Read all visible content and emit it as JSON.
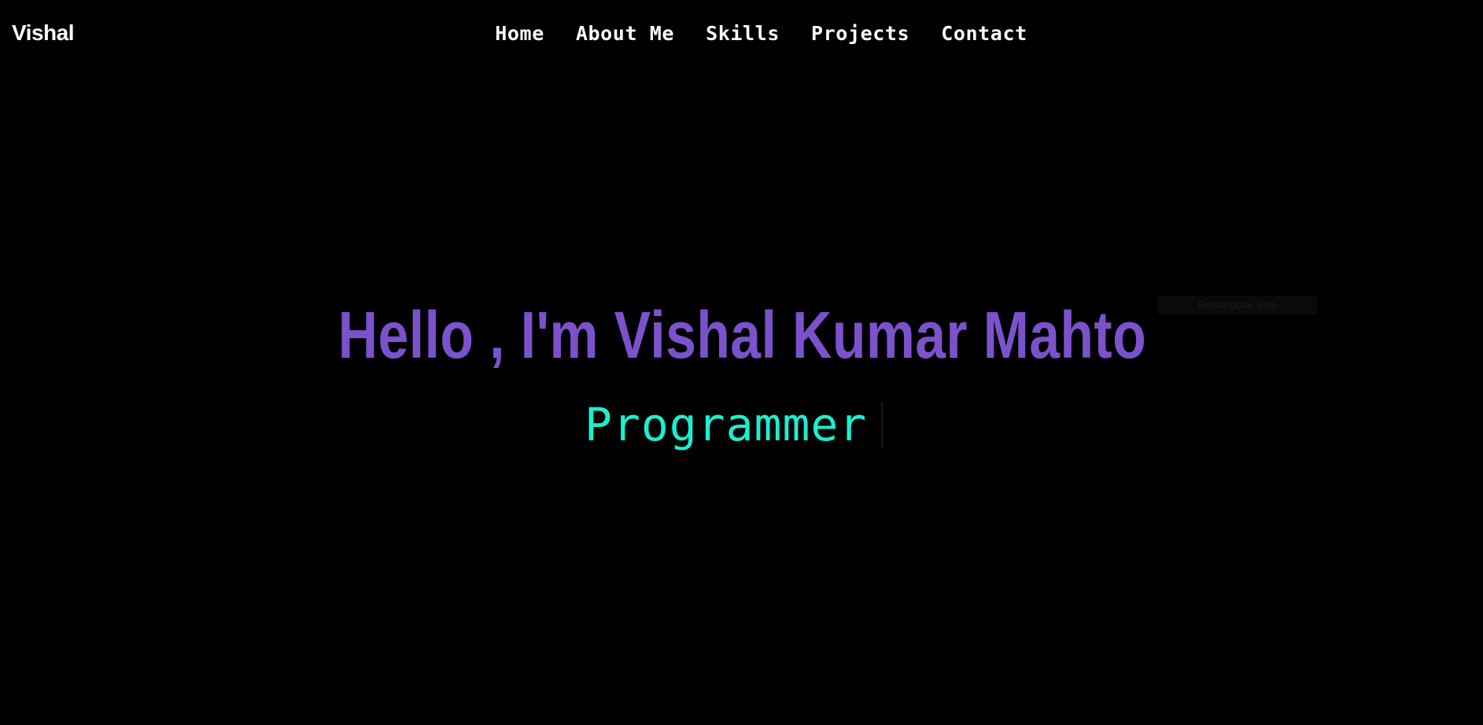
{
  "brand": {
    "label": "Vishal"
  },
  "nav": {
    "items": [
      {
        "label": "Home"
      },
      {
        "label": "About Me"
      },
      {
        "label": "Skills"
      },
      {
        "label": "Projects"
      },
      {
        "label": "Contact"
      }
    ]
  },
  "hero": {
    "title": "Hello , I'm Vishal Kumar Mahto",
    "typed_text": "Programmer"
  },
  "overlay": {
    "snip_label": "Rectangular Snip"
  },
  "colors": {
    "background": "#000000",
    "nav_text": "#ffffff",
    "title": "#7b52cc",
    "typed": "#19f0d0"
  }
}
